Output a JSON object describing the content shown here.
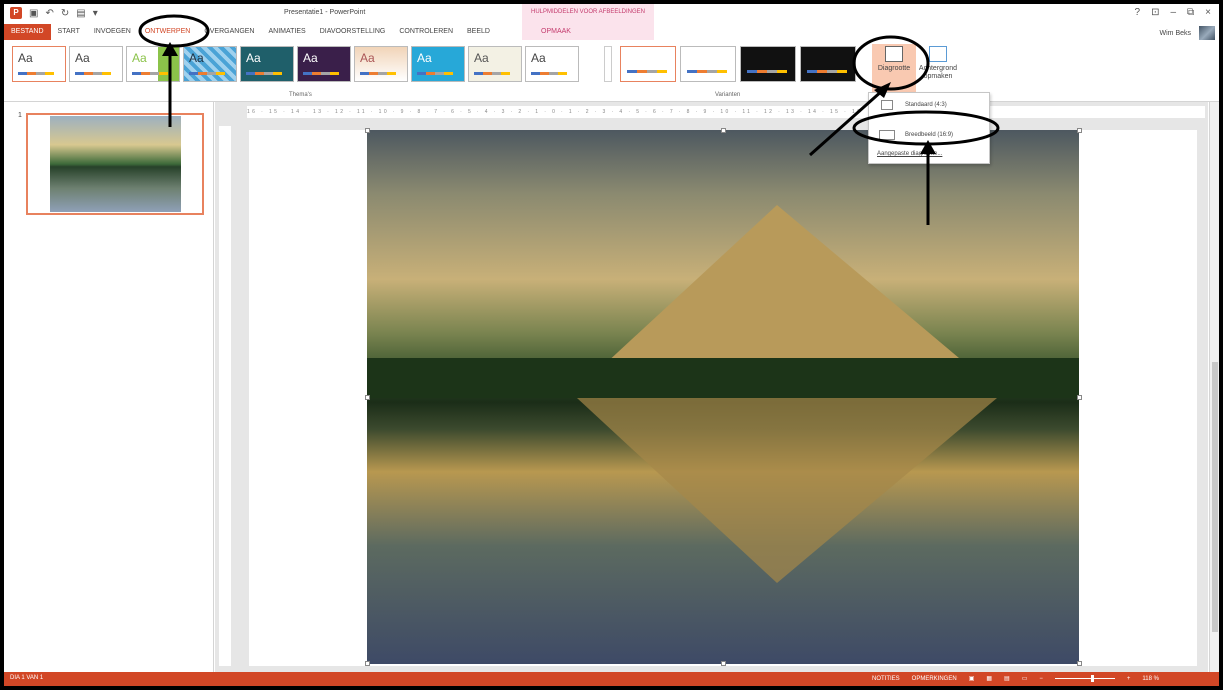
{
  "titlebar": {
    "document_title": "Presentatie1 - PowerPoint",
    "context_group": "HULPMIDDELEN VOOR AFBEELDINGEN",
    "window_controls": [
      "?",
      "⊡",
      "–",
      "⧉",
      "×"
    ],
    "user_name": "Wim Beks"
  },
  "tabs": [
    "BESTAND",
    "START",
    "INVOEGEN",
    "ONTWERPEN",
    "OVERGANGEN",
    "ANIMATIES",
    "DIAVOORSTELLING",
    "CONTROLEREN",
    "BEELD"
  ],
  "context_tab": "OPMAAK",
  "active_tab": "ONTWERPEN",
  "ribbon": {
    "theme_label": "Aa",
    "themes_group": "Thema's",
    "variants_group": "Varianten",
    "slide_size_button": "Diagrootte",
    "background_button_line1": "Achtergrond",
    "background_button_line2": "opmaken"
  },
  "dropdown": {
    "standard": "Standaard (4:3)",
    "widescreen": "Breedbeeld (16:9)",
    "custom": "Aangepaste diagrootte..."
  },
  "slide_number": "1",
  "ruler_text": "16 · 15 · 14 · 13 · 12 · 11 · 10 · 9 · 8 · 7 · 6 · 5 · 4 · 3 · 2 · 1 · 0 · 1 · 2 · 3 · 4 · 5 · 6 · 7 · 8 · 9 · 10 · 11 · 12 · 13 · 14 · 15 · 16",
  "statusbar": {
    "slide_info": "DIA 1 VAN 1",
    "notes": "NOTITIES",
    "comments": "OPMERKINGEN",
    "zoom": "118 %"
  },
  "colors": {
    "accent": "#d24726",
    "context": "#c43b6d"
  }
}
